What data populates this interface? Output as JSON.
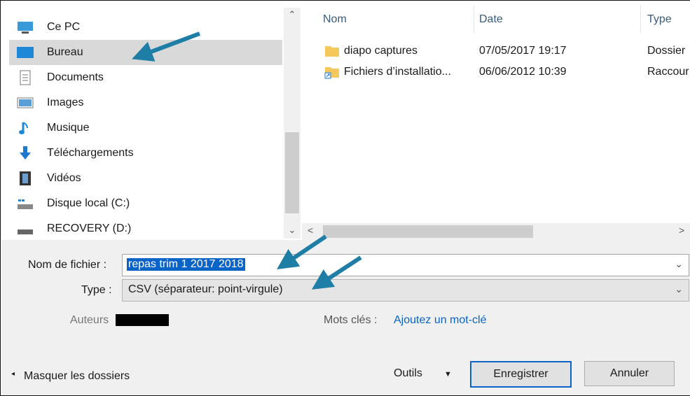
{
  "navigation": {
    "items": [
      {
        "label": "Ce PC",
        "icon": "computer-icon"
      },
      {
        "label": "Bureau",
        "icon": "desktop-icon",
        "selected": true
      },
      {
        "label": "Documents",
        "icon": "documents-icon"
      },
      {
        "label": "Images",
        "icon": "images-icon"
      },
      {
        "label": "Musique",
        "icon": "music-icon"
      },
      {
        "label": "Téléchargements",
        "icon": "download-icon"
      },
      {
        "label": "Vidéos",
        "icon": "videos-icon"
      },
      {
        "label": "Disque local (C:)",
        "icon": "local-disk-icon"
      },
      {
        "label": "RECOVERY (D:)",
        "icon": "drive-icon"
      }
    ]
  },
  "files": {
    "columns": {
      "name": "Nom",
      "date": "Date",
      "type": "Type"
    },
    "rows": [
      {
        "name": "diapo captures",
        "date": "07/05/2017 19:17",
        "type": "Dossier",
        "icon": "folder-icon"
      },
      {
        "name": "Fichiers d’installatio...",
        "date": "06/06/2012 10:39",
        "type": "Raccour",
        "icon": "shortcut-folder-icon"
      }
    ]
  },
  "form": {
    "filename_label": "Nom de fichier :",
    "filename_value": "repas trim 1 2017 2018",
    "type_label": "Type :",
    "type_value": "CSV (séparateur: point-virgule)",
    "authors_label": "Auteurs",
    "tags_label": "Mots clés :",
    "tags_link": "Ajoutez un mot-clé"
  },
  "footer": {
    "hide_folders": "Masquer les dossiers",
    "tools": "Outils",
    "save": "Enregistrer",
    "cancel": "Annuler"
  },
  "colors": {
    "accent": "#0a64c8",
    "annotation_arrow": "#1f7ea6"
  }
}
